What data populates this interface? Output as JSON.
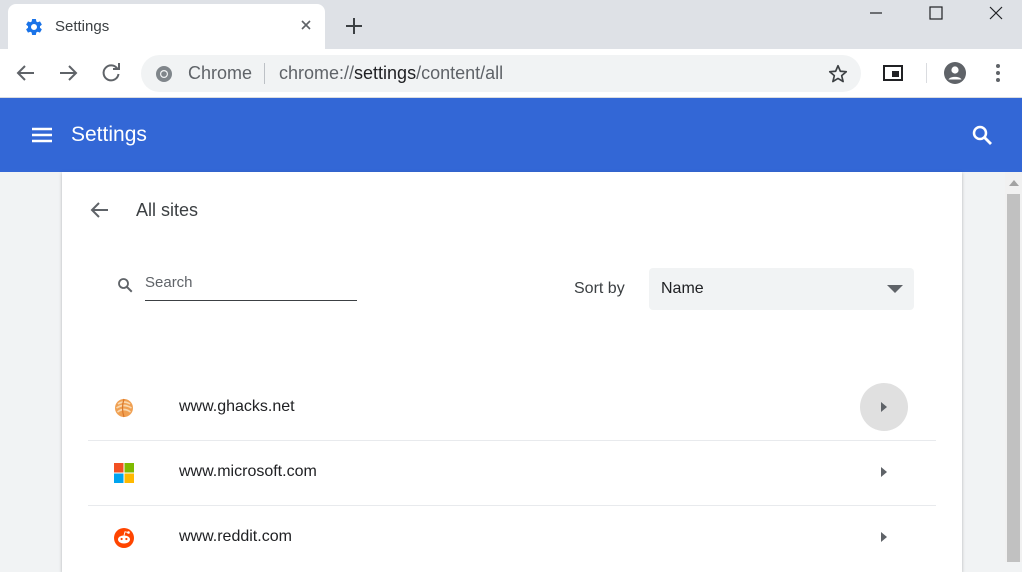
{
  "browser": {
    "tab": {
      "title": "Settings",
      "favicon": "gear-icon"
    },
    "omnibox": {
      "site_label": "Chrome",
      "url_scheme": "chrome://",
      "url_host": "settings",
      "url_path": "/content/all"
    }
  },
  "appbar": {
    "title": "Settings",
    "menu_icon": "hamburger-icon",
    "search_icon": "search-icon"
  },
  "page": {
    "title": "All sites",
    "search": {
      "placeholder": "Search",
      "value": ""
    },
    "sort": {
      "label": "Sort by",
      "value": "Name"
    },
    "sites": [
      {
        "name": "www.ghacks.net",
        "icon": "ghacks-favicon-icon"
      },
      {
        "name": "www.microsoft.com",
        "icon": "microsoft-favicon-icon"
      },
      {
        "name": "www.reddit.com",
        "icon": "reddit-favicon-icon"
      }
    ]
  },
  "colors": {
    "accent": "#3367d6",
    "chrome_blue": "#1a73e8"
  }
}
